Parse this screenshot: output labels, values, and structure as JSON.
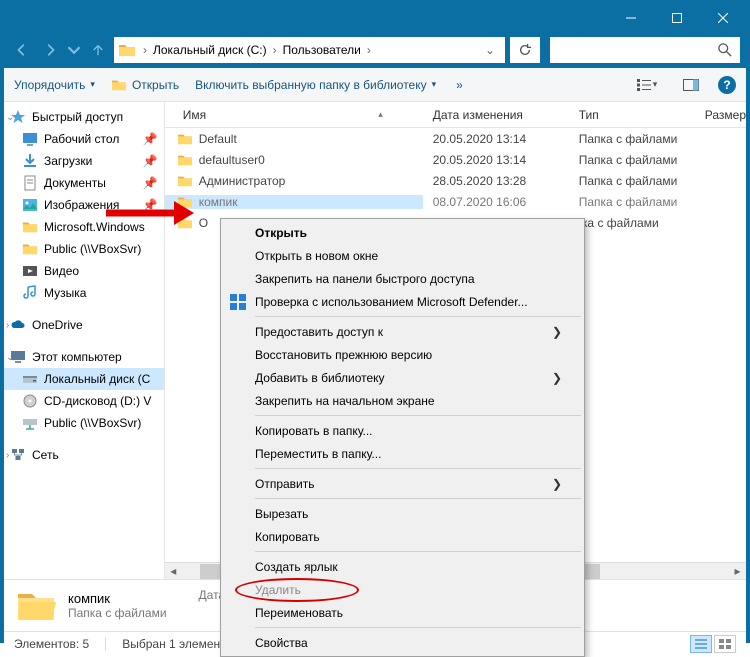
{
  "breadcrumbs": {
    "seg1": "Локальный диск (C:)",
    "seg2": "Пользователи"
  },
  "toolbar": {
    "organize": "Упорядочить",
    "open": "Открыть",
    "include": "Включить выбранную папку в библиотеку"
  },
  "columns": {
    "name": "Имя",
    "date": "Дата изменения",
    "type": "Тип",
    "size": "Размер"
  },
  "sidebar": {
    "quick": "Быстрый доступ",
    "desktop": "Рабочий стол",
    "downloads": "Загрузки",
    "documents": "Документы",
    "pictures": "Изображения",
    "mswin": "Microsoft.Windows",
    "public": "Public (\\\\VBoxSvr)",
    "videos": "Видео",
    "music": "Музыка",
    "onedrive": "OneDrive",
    "thispc": "Этот компьютер",
    "localdisk": "Локальный диск (C",
    "cddrive": "CD-дисковод (D:) V",
    "public2": "Public (\\\\VBoxSvr)",
    "network": "Сеть"
  },
  "files": [
    {
      "name": "Default",
      "date": "20.05.2020 13:14",
      "type": "Папка с файлами"
    },
    {
      "name": "defaultuser0",
      "date": "20.05.2020 13:14",
      "type": "Папка с файлами"
    },
    {
      "name": "Администратор",
      "date": "28.05.2020 13:28",
      "type": "Папка с файлами"
    },
    {
      "name": "компик",
      "date": "08.07.2020 16:06",
      "type": "Папка с файлами"
    },
    {
      "name": "О",
      "date": "",
      "type": "апка с файлами"
    }
  ],
  "contextmenu": {
    "open": "Открыть",
    "openNew": "Открыть в новом окне",
    "pinQuick": "Закрепить на панели быстрого доступа",
    "defender": "Проверка с использованием Microsoft Defender...",
    "giveAccess": "Предоставить доступ к",
    "restore": "Восстановить прежнюю версию",
    "addLib": "Добавить в библиотеку",
    "pinStart": "Закрепить на начальном экране",
    "copyTo": "Копировать в папку...",
    "moveTo": "Переместить в папку...",
    "sendTo": "Отправить",
    "cut": "Вырезать",
    "copy": "Копировать",
    "shortcut": "Создать ярлык",
    "delete": "Удалить",
    "rename": "Переименовать",
    "properties": "Свойства"
  },
  "details": {
    "name": "компик",
    "type": "Папка с файлами",
    "dateLabel": "Дата"
  },
  "status": {
    "count": "Элементов: 5",
    "selected": "Выбран 1 элемент"
  }
}
